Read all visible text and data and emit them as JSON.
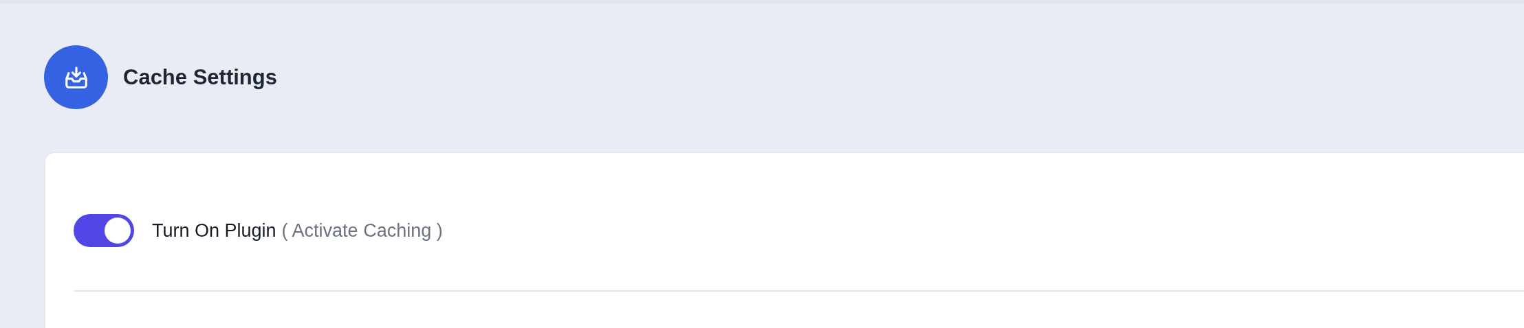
{
  "header": {
    "title": "Cache Settings"
  },
  "settings": [
    {
      "kind": "toggle",
      "label": "Turn On Plugin",
      "hint": "( Activate Caching )",
      "on": true
    }
  ]
}
